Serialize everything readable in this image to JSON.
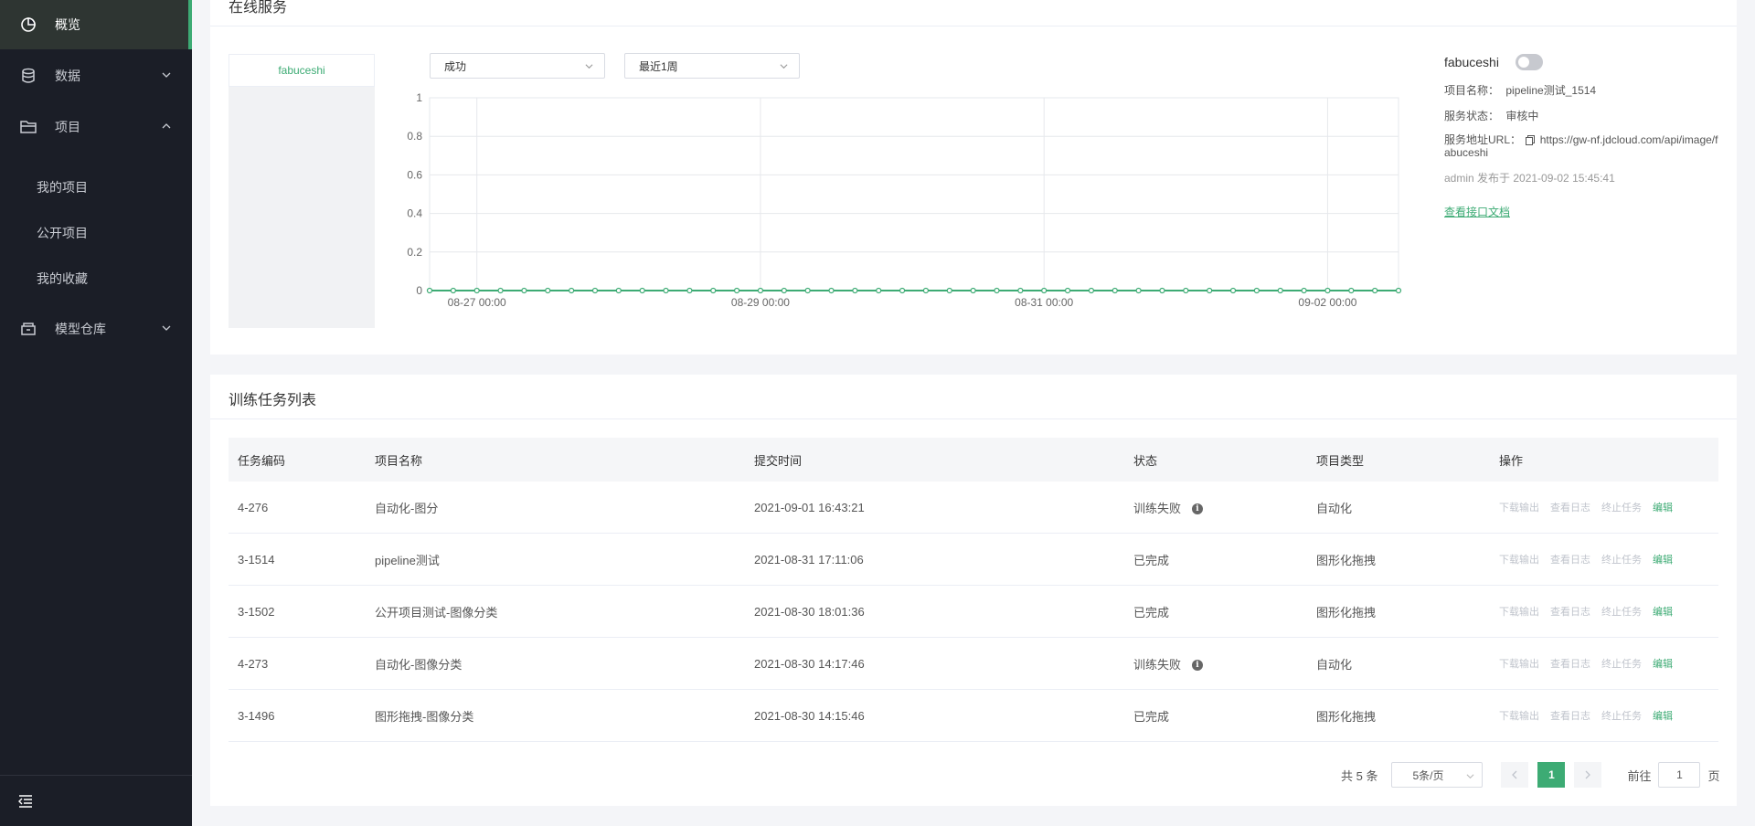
{
  "sidebar": {
    "items": [
      {
        "label": "概览"
      },
      {
        "label": "数据"
      },
      {
        "label": "项目"
      },
      {
        "label": "模型仓库"
      }
    ],
    "sub_items": [
      {
        "label": "我的项目"
      },
      {
        "label": "公开项目"
      },
      {
        "label": "我的收藏"
      }
    ]
  },
  "online_service": {
    "title": "在线服务",
    "service_list": [
      "fabuceshi"
    ],
    "status_select": "成功",
    "range_select": "最近1周",
    "info": {
      "name": "fabuceshi",
      "project_label": "项目名称：",
      "project_value": "pipeline测试_1514",
      "status_label": "服务状态：",
      "status_value": "审核中",
      "url_label": "服务地址URL：",
      "url_line1": "https://gw-nf.jdcloud.com/api/image/f",
      "url_line2": "abuceshi",
      "published": "admin 发布于 2021-09-02 15:45:41",
      "doc_link": "查看接口文档"
    }
  },
  "chart_data": {
    "type": "line",
    "title": "",
    "xlabel": "",
    "ylabel": "",
    "ylim": [
      0,
      1
    ],
    "yticks": [
      "0",
      "0.2",
      "0.4",
      "0.6",
      "0.8",
      "1"
    ],
    "xticks": [
      "08-27 00:00",
      "08-29 00:00",
      "08-31 00:00",
      "09-02 00:00"
    ],
    "grid": true,
    "colors": {
      "line": "#3dab74",
      "grid": "#e6e8ec"
    },
    "series": [
      {
        "values": [
          0,
          0,
          0,
          0,
          0,
          0,
          0,
          0,
          0,
          0,
          0,
          0,
          0,
          0,
          0,
          0,
          0,
          0,
          0,
          0,
          0,
          0,
          0,
          0,
          0,
          0,
          0,
          0,
          0,
          0,
          0,
          0,
          0,
          0,
          0,
          0,
          0,
          0,
          0,
          0,
          0,
          0
        ]
      }
    ]
  },
  "training": {
    "title": "训练任务列表",
    "columns": [
      "任务编码",
      "项目名称",
      "提交时间",
      "状态",
      "项目类型",
      "操作"
    ],
    "rows": [
      {
        "id": "4-276",
        "name": "自动化-图分",
        "time": "2021-09-01 16:43:21",
        "status": "训练失败",
        "type": "自动化",
        "info": true
      },
      {
        "id": "3-1514",
        "name": "pipeline测试",
        "time": "2021-08-31 17:11:06",
        "status": "已完成",
        "type": "图形化拖拽",
        "info": false
      },
      {
        "id": "3-1502",
        "name": "公开项目测试-图像分类",
        "time": "2021-08-30 18:01:36",
        "status": "已完成",
        "type": "图形化拖拽",
        "info": false
      },
      {
        "id": "4-273",
        "name": "自动化-图像分类",
        "time": "2021-08-30 14:17:46",
        "status": "训练失败",
        "type": "自动化",
        "info": true
      },
      {
        "id": "3-1496",
        "name": "图形拖拽-图像分类",
        "time": "2021-08-30 14:15:46",
        "status": "已完成",
        "type": "图形化拖拽",
        "info": false
      }
    ],
    "ops": [
      "下载输出",
      "查看日志",
      "终止任务",
      "编辑"
    ]
  },
  "pager": {
    "total": "共 5 条",
    "page_size": "5条/页",
    "current": "1",
    "goto_prefix": "前往",
    "goto_value": "1",
    "goto_suffix": "页"
  },
  "colors": {
    "accent": "#3dab74",
    "sidebar_bg": "#1b1e27"
  }
}
